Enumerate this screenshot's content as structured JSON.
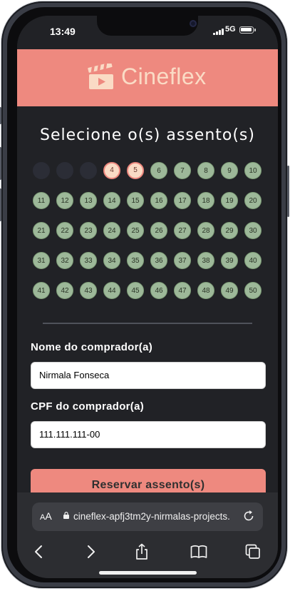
{
  "status_bar": {
    "time": "13:49",
    "network": "5G"
  },
  "app": {
    "name": "Cineflex"
  },
  "seat_section": {
    "title": "Selecione o(s) assento(s)",
    "unavailable": [
      1,
      2,
      3
    ],
    "selected": [
      4,
      5
    ],
    "seats": [
      "1",
      "2",
      "3",
      "4",
      "5",
      "6",
      "7",
      "8",
      "9",
      "10",
      "11",
      "12",
      "13",
      "14",
      "15",
      "16",
      "17",
      "18",
      "19",
      "20",
      "21",
      "22",
      "23",
      "24",
      "25",
      "26",
      "27",
      "28",
      "29",
      "30",
      "31",
      "32",
      "33",
      "34",
      "35",
      "36",
      "37",
      "38",
      "39",
      "40",
      "41",
      "42",
      "43",
      "44",
      "45",
      "46",
      "47",
      "48",
      "49",
      "50"
    ]
  },
  "form": {
    "name_label": "Nome do comprador(a)",
    "name_value": "Nirmala Fonseca",
    "cpf_label": "CPF do comprador(a)",
    "cpf_value": "111.111.111-00",
    "submit_label": "Reservar assento(s)"
  },
  "browser": {
    "text_size_label": "AA",
    "url": "cineflex-apfj3tm2y-nirmalas-projects."
  },
  "colors": {
    "accent": "#ee897f",
    "logo": "#fadbc5",
    "seat_available": "#9db899",
    "seat_unavailable": "#2b2d36",
    "background": "#212226"
  }
}
